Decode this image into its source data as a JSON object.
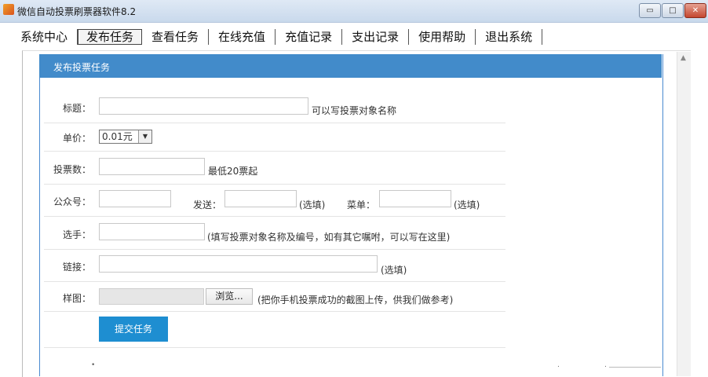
{
  "window": {
    "title": "微信自动投票刷票器软件8.2",
    "controls": {
      "minimize": "▭",
      "maximize": "□",
      "close": "✕"
    }
  },
  "tabs": [
    {
      "label": "系统中心"
    },
    {
      "label": "发布任务",
      "active": true
    },
    {
      "label": "查看任务"
    },
    {
      "label": "在线充值"
    },
    {
      "label": "充值记录"
    },
    {
      "label": "支出记录"
    },
    {
      "label": "使用帮助"
    },
    {
      "label": "退出系统"
    }
  ],
  "panel": {
    "title": "发布投票任务"
  },
  "form": {
    "title": {
      "label": "标题：",
      "value": "",
      "hint": "可以写投票对象名称"
    },
    "price": {
      "label": "单价：",
      "selected": "0.01元"
    },
    "vote_count": {
      "label": "投票数：",
      "value": "",
      "hint": "最低20票起"
    },
    "official_account": {
      "label": "公众号：",
      "value": ""
    },
    "send": {
      "label": "发送：",
      "value": "",
      "hint": "(选填)"
    },
    "menu": {
      "label": "菜单：",
      "value": "",
      "hint": "(选填)"
    },
    "contestant": {
      "label": "选手：",
      "value": "",
      "hint": "(填写投票对象名称及编号，如有其它嘱咐，可以写在这里)"
    },
    "link": {
      "label": "链接：",
      "value": "",
      "hint": "(选填)"
    },
    "sample_image": {
      "label": "样图：",
      "browse": "浏览...",
      "hint": "(把你手机投票成功的截图上传，供我们做参考)"
    },
    "submit": "提交任务"
  },
  "colors": {
    "header_blue": "#428bca",
    "submit_blue": "#1e8ed1"
  },
  "icons": {
    "app": "app-icon",
    "dropdown": "dropdown-arrow-icon",
    "scroll_up": "scroll-up-icon"
  }
}
